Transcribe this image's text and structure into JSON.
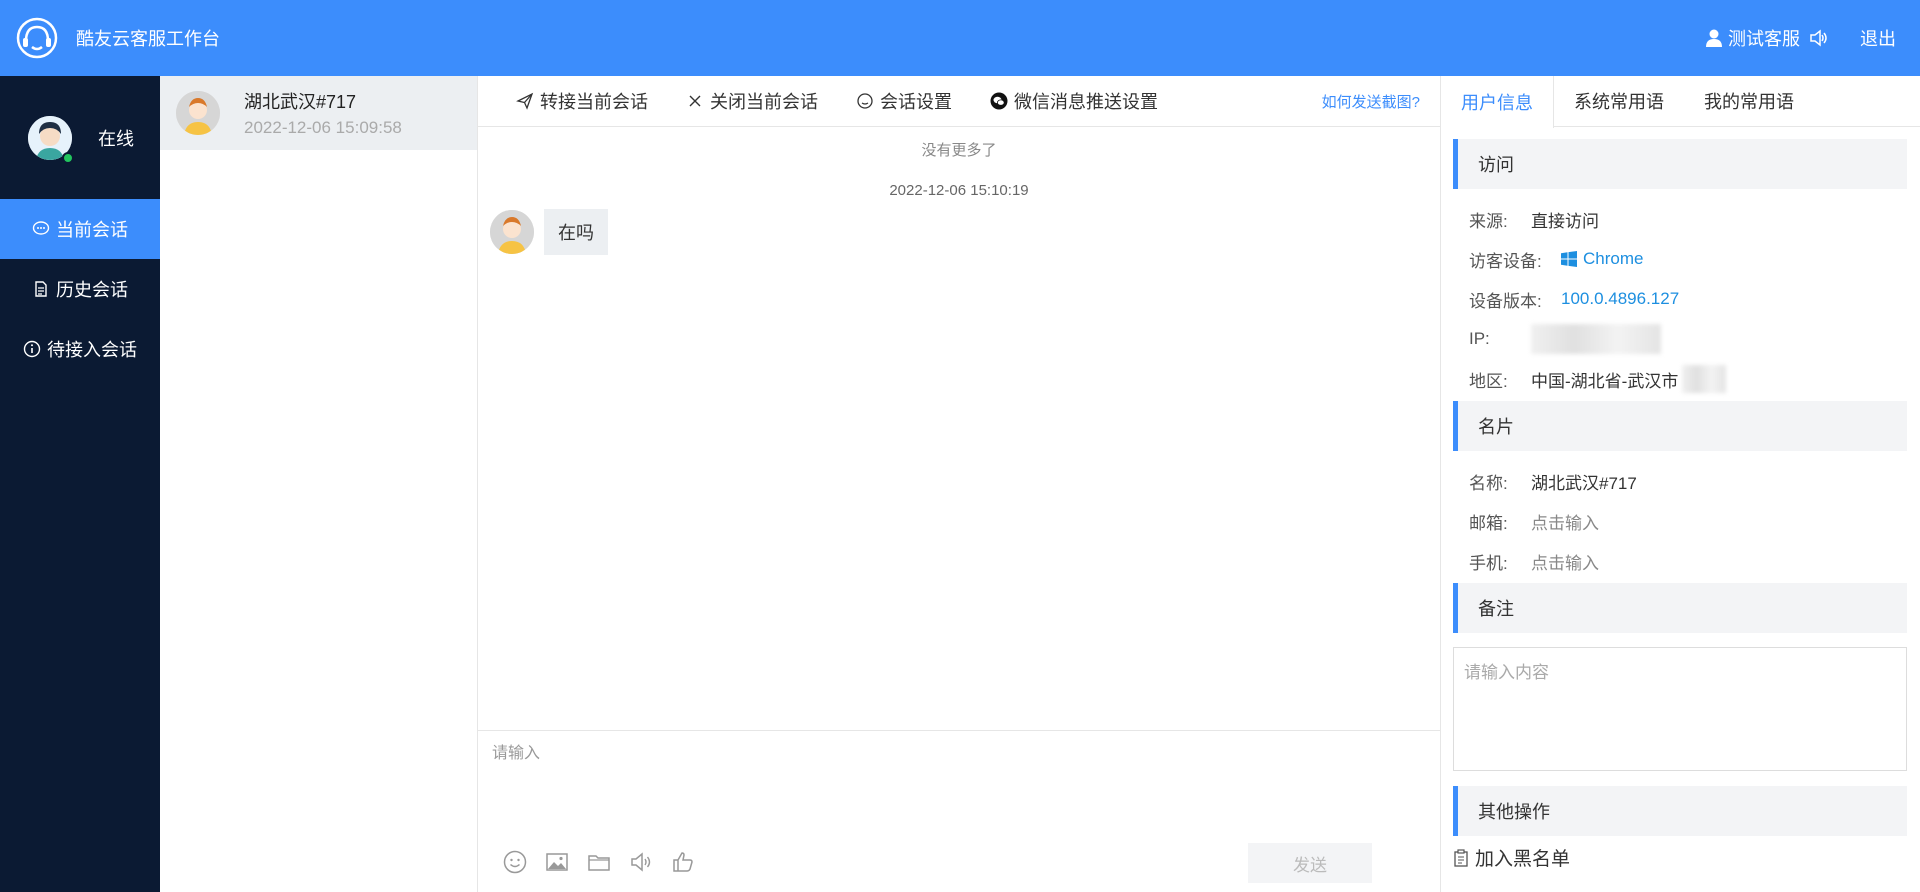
{
  "header": {
    "title": "酷友云客服工作台",
    "agent_name": "测试客服",
    "logout": "退出"
  },
  "sidebar": {
    "status": "在线",
    "items": [
      {
        "label": "当前会话",
        "icon": "chat-bubble-icon",
        "active": true
      },
      {
        "label": "历史会话",
        "icon": "document-icon",
        "active": false
      },
      {
        "label": "待接入会话",
        "icon": "info-icon",
        "active": false
      }
    ]
  },
  "conversations": [
    {
      "name": "湖北武汉#717",
      "time": "2022-12-06 15:09:58"
    }
  ],
  "toolbar": {
    "transfer": "转接当前会话",
    "close": "关闭当前会话",
    "settings": "会话设置",
    "wechat": "微信消息推送设置",
    "howto": "如何发送截图?"
  },
  "chat": {
    "no_more": "没有更多了",
    "message_time": "2022-12-06 15:10:19",
    "messages": [
      {
        "from": "visitor",
        "text": "在吗"
      }
    ]
  },
  "composer": {
    "placeholder": "请输入",
    "send": "发送"
  },
  "right_panel": {
    "tabs": [
      "用户信息",
      "系统常用语",
      "我的常用语"
    ],
    "visit": {
      "title": "访问",
      "source_label": "来源:",
      "source_value": "直接访问",
      "device_label": "访客设备:",
      "device_value": "Chrome",
      "version_label": "设备版本:",
      "version_value": "100.0.4896.127",
      "ip_label": "IP:",
      "region_label": "地区:",
      "region_value": "中国-湖北省-武汉市"
    },
    "card": {
      "title": "名片",
      "name_label": "名称:",
      "name_value": "湖北武汉#717",
      "email_label": "邮箱:",
      "email_value": "点击输入",
      "phone_label": "手机:",
      "phone_value": "点击输入"
    },
    "notes": {
      "title": "备注",
      "placeholder": "请输入内容"
    },
    "other": {
      "title": "其他操作",
      "blacklist": "加入黑名单"
    }
  },
  "colors": {
    "brand": "#3c8dfc",
    "sidebar_bg": "#0b1a33",
    "online": "#22c55e"
  }
}
